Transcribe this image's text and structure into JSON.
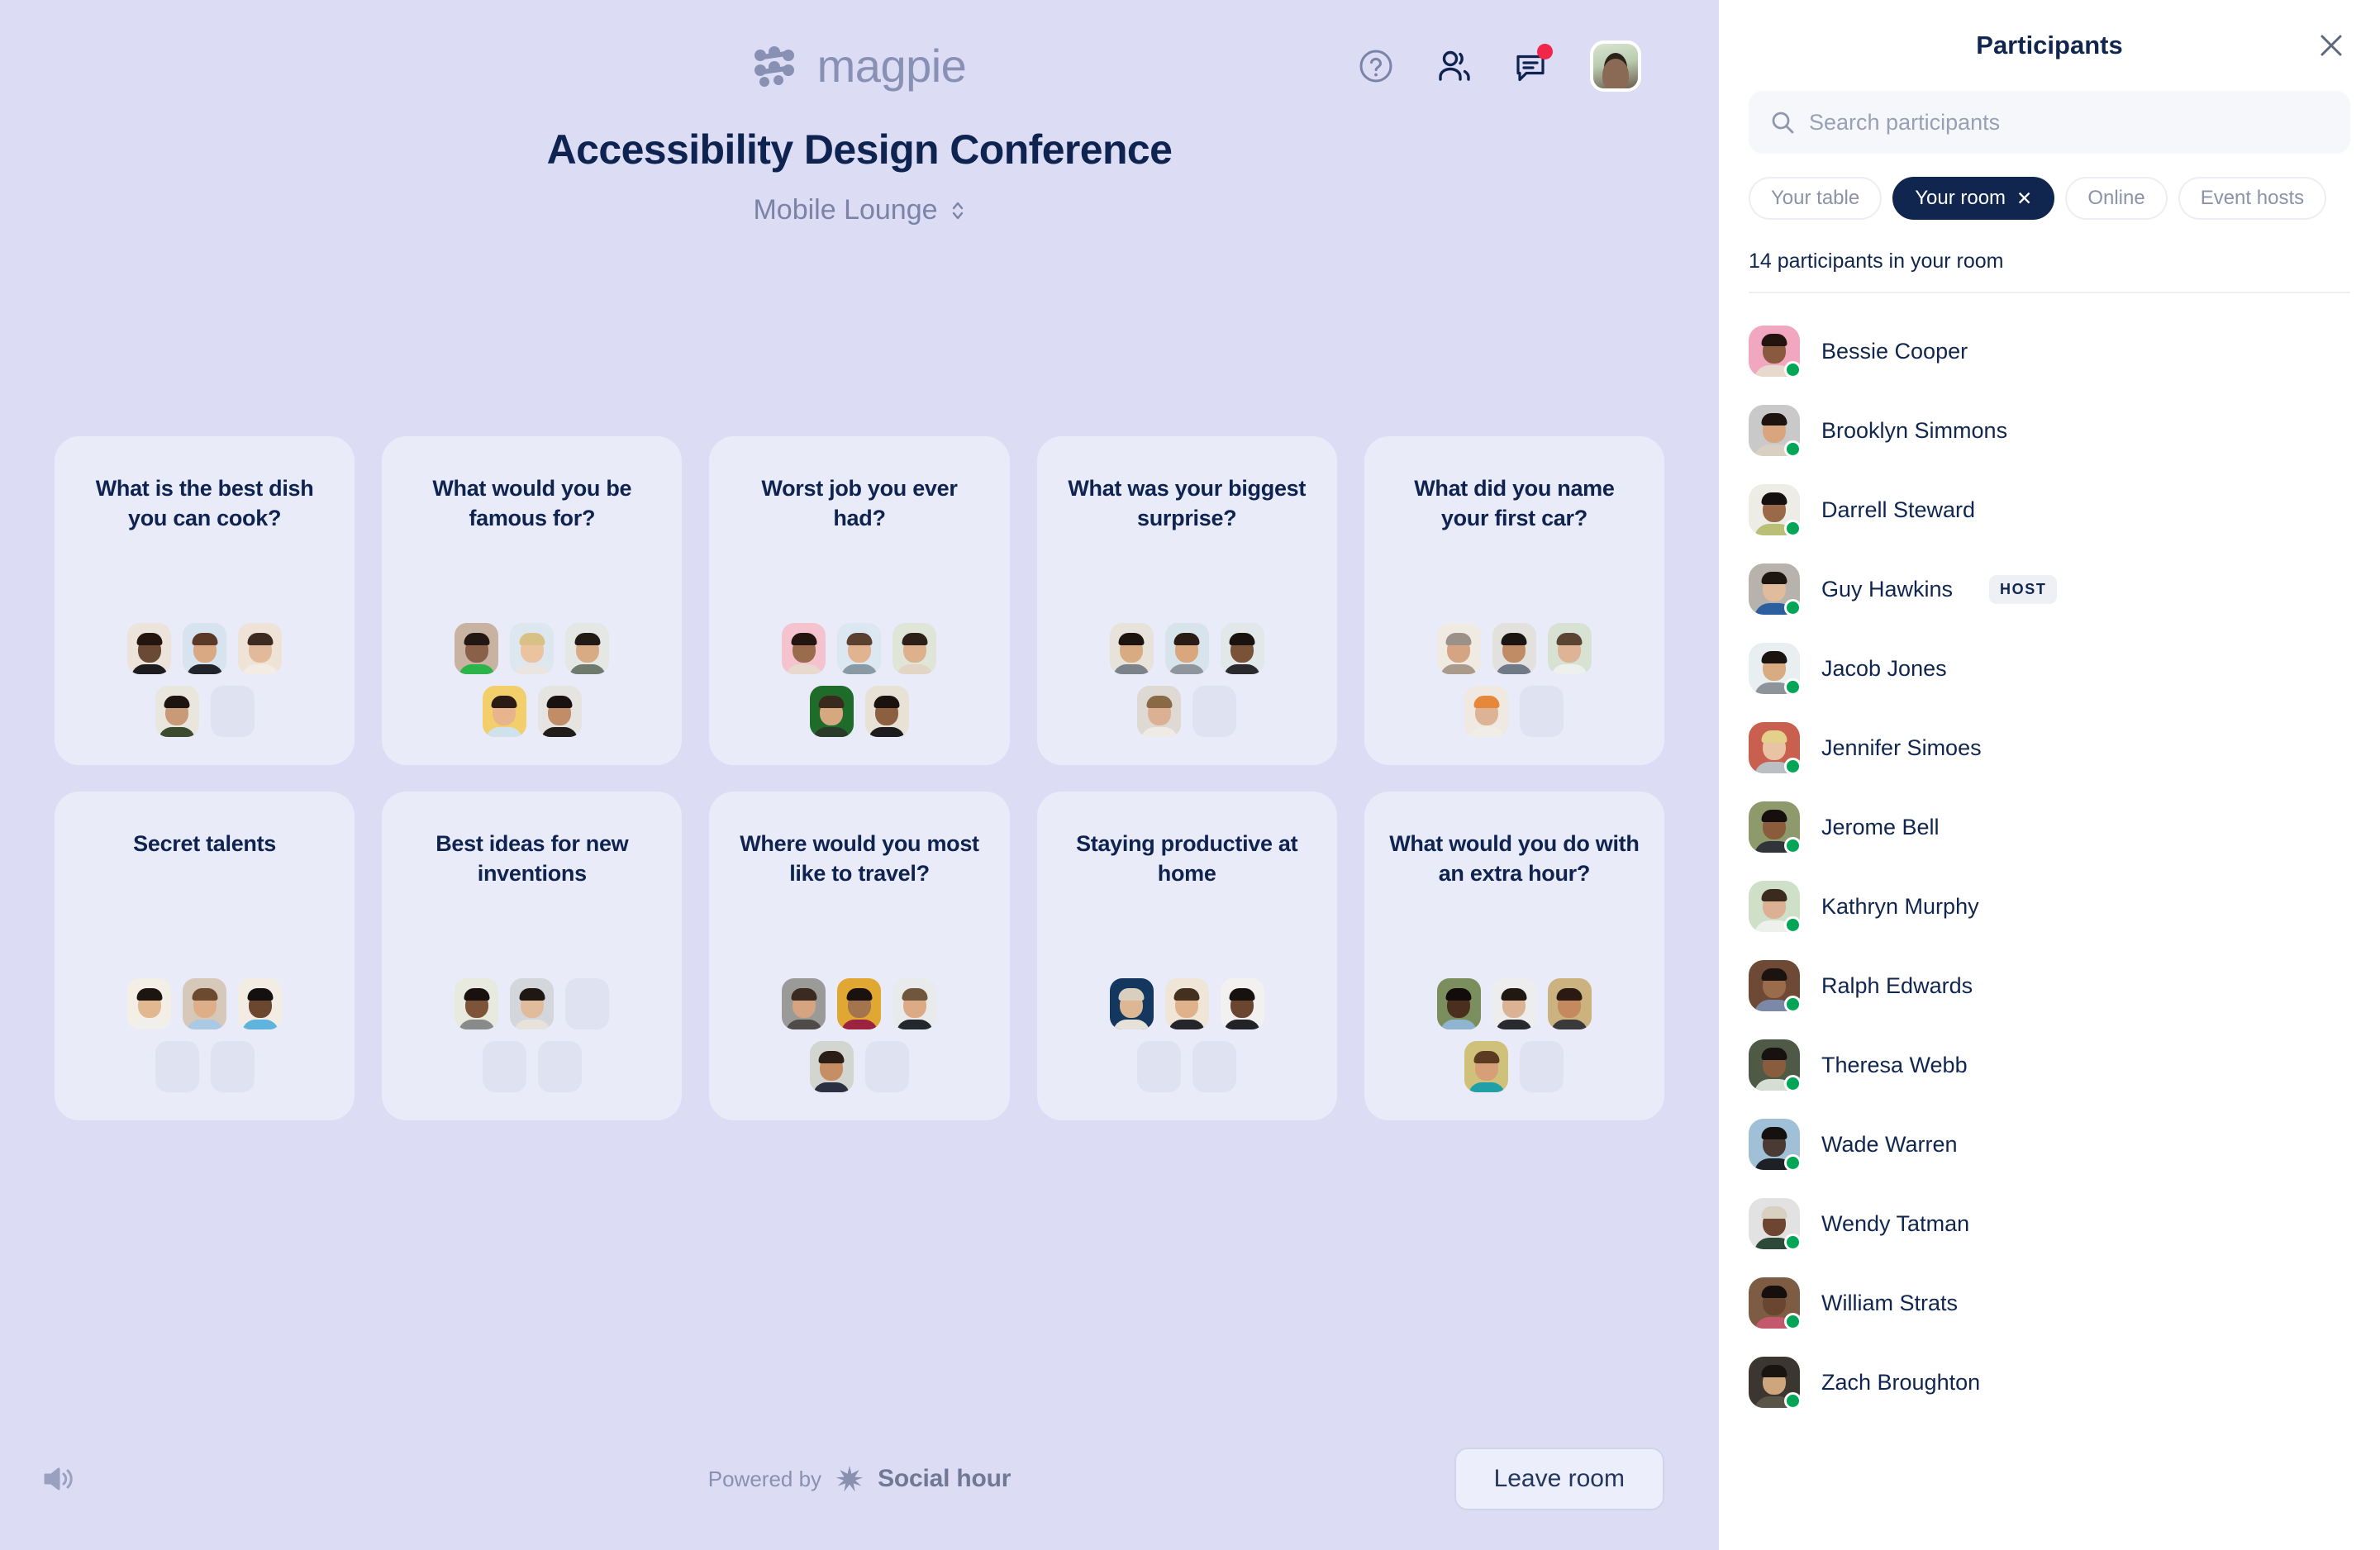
{
  "brand": {
    "name": "magpie",
    "logo_icon": "magpie-logo-icon"
  },
  "header": {
    "event_title": "Accessibility Design Conference",
    "room_name": "Mobile Lounge",
    "room_caret_icon": "chevron-updown-icon",
    "help_icon": "help-circle-icon",
    "participants_icon": "people-icon",
    "chat_icon": "chat-bubble-icon",
    "chat_badge": true,
    "avatar_icon": "user-avatar"
  },
  "topics": [
    {
      "title": "What is the best dish you can cook?",
      "seats": [
        {
          "occupied": true,
          "bg": "#ece4da",
          "head": "#6a4a35",
          "hair": "#24160f",
          "body": "#1c1c20"
        },
        {
          "occupied": true,
          "bg": "#d7e3ee",
          "head": "#d8a983",
          "hair": "#5a3a27",
          "body": "#22242c"
        },
        {
          "occupied": true,
          "bg": "#efe2d6",
          "head": "#e2b99b",
          "hair": "#3d2a20",
          "body": "#f2ece4"
        },
        {
          "occupied": true,
          "bg": "#e9e7dd",
          "head": "#c89a78",
          "hair": "#1d1410",
          "body": "#3c4a2e"
        },
        {
          "occupied": false
        }
      ]
    },
    {
      "title": "What would you be famous for?",
      "seats": [
        {
          "occupied": true,
          "bg": "#c8b2a1",
          "head": "#8a6148",
          "hair": "#221712",
          "body": "#2cb34a"
        },
        {
          "occupied": true,
          "bg": "#dde7ef",
          "head": "#ecc39f",
          "hair": "#d9c084",
          "body": "#e9e6e2"
        },
        {
          "occupied": true,
          "bg": "#e4e7e3",
          "head": "#d8ab85",
          "hair": "#221a14",
          "body": "#6e7a6b"
        },
        {
          "occupied": true,
          "bg": "#f2cf6a",
          "head": "#e7b48d",
          "hair": "#2a1c14",
          "body": "#cfe2ec"
        },
        {
          "occupied": true,
          "bg": "#e6e4e1",
          "head": "#c08d66",
          "hair": "#1a1210",
          "body": "#201d1c"
        }
      ]
    },
    {
      "title": "Worst job you ever had?",
      "seats": [
        {
          "occupied": true,
          "bg": "#f4c3cd",
          "head": "#9a6b4c",
          "hair": "#241510",
          "body": "#e7d9cd"
        },
        {
          "occupied": true,
          "bg": "#dce8f1",
          "head": "#e2b391",
          "hair": "#5d4130",
          "body": "#8a9aa5"
        },
        {
          "occupied": true,
          "bg": "#dfe6d8",
          "head": "#dcb18c",
          "hair": "#2e2018",
          "body": "#e3d5c6"
        },
        {
          "occupied": true,
          "bg": "#1f6b2a",
          "head": "#d6a87f",
          "hair": "#3a2a1d",
          "body": "#2a3b2a"
        },
        {
          "occupied": true,
          "bg": "#e8e1d6",
          "head": "#8b5f40",
          "hair": "#1b1210",
          "body": "#1e1c1f"
        }
      ]
    },
    {
      "title": "What was your biggest surprise?",
      "seats": [
        {
          "occupied": true,
          "bg": "#e7e3da",
          "head": "#d8ab83",
          "hair": "#1d1410",
          "body": "#7c8289"
        },
        {
          "occupied": true,
          "bg": "#d8e4ec",
          "head": "#d9a67e",
          "hair": "#2a1c14",
          "body": "#8e959c"
        },
        {
          "occupied": true,
          "bg": "#e2e7ea",
          "head": "#7a5238",
          "hair": "#1a120e",
          "body": "#2a2a2e"
        },
        {
          "occupied": true,
          "bg": "#ded9d2",
          "head": "#dcb092",
          "hair": "#8a6a46",
          "body": "#eeebe6"
        },
        {
          "occupied": false
        }
      ]
    },
    {
      "title": "What did you name your first car?",
      "seats": [
        {
          "occupied": true,
          "bg": "#efeae2",
          "head": "#d4a483",
          "hair": "#9c9188",
          "body": "#a99a8c"
        },
        {
          "occupied": true,
          "bg": "#e3e1de",
          "head": "#c08c66",
          "hair": "#1c1410",
          "body": "#6f7a86"
        },
        {
          "occupied": true,
          "bg": "#d7e2d2",
          "head": "#dfb396",
          "hair": "#5b4432",
          "body": "#eef0ee"
        },
        {
          "occupied": true,
          "bg": "#efe9e1",
          "head": "#ddb395",
          "hair": "#e5883a",
          "body": "#f0ece6"
        },
        {
          "occupied": false
        }
      ]
    },
    {
      "title": "Secret talents",
      "seats": [
        {
          "occupied": true,
          "bg": "#f3efe6",
          "head": "#e1b890",
          "hair": "#1d1510",
          "body": "#f0efec"
        },
        {
          "occupied": true,
          "bg": "#d7c9ba",
          "head": "#ddae87",
          "hair": "#6b4a30",
          "body": "#a9c9e4"
        },
        {
          "occupied": true,
          "bg": "#f2ece2",
          "head": "#6c4730",
          "hair": "#141010",
          "body": "#5fb4de"
        },
        {
          "occupied": false
        },
        {
          "occupied": false
        }
      ]
    },
    {
      "title": "Best ideas for new inventions",
      "seats": [
        {
          "occupied": true,
          "bg": "#e8eadf",
          "head": "#7d5438",
          "hair": "#181110",
          "body": "#8a8a8a"
        },
        {
          "occupied": true,
          "bg": "#d3d6da",
          "head": "#e0bc9c",
          "hair": "#1e1712",
          "body": "#e8e3da"
        },
        {
          "occupied": false
        },
        {
          "occupied": false
        },
        {
          "occupied": false
        }
      ]
    },
    {
      "title": "Where would you most like to travel?",
      "seats": [
        {
          "occupied": true,
          "bg": "#9a9a99",
          "head": "#d6a480",
          "hair": "#3a2a1f",
          "body": "#4e4b49"
        },
        {
          "occupied": true,
          "bg": "#e0a832",
          "head": "#a3754f",
          "hair": "#1a1210",
          "body": "#9c2340"
        },
        {
          "occupied": true,
          "bg": "#e8eaec",
          "head": "#dcaa84",
          "hair": "#6f563c",
          "body": "#23272e"
        },
        {
          "occupied": true,
          "bg": "#d3d5d0",
          "head": "#c58e63",
          "hair": "#2c1e16",
          "body": "#2b3140"
        },
        {
          "occupied": false
        }
      ]
    },
    {
      "title": "Staying productive at home",
      "seats": [
        {
          "occupied": true,
          "bg": "#14375f",
          "head": "#ddb794",
          "hair": "#d8cfbe",
          "body": "#e6e2da"
        },
        {
          "occupied": true,
          "bg": "#efe6d8",
          "head": "#e0b28c",
          "hair": "#43301f",
          "body": "#25262b"
        },
        {
          "occupied": true,
          "bg": "#f2f1ef",
          "head": "#6a4530",
          "hair": "#171210",
          "body": "#232327"
        },
        {
          "occupied": false
        },
        {
          "occupied": false
        }
      ]
    },
    {
      "title": "What would you do with an extra hour?",
      "seats": [
        {
          "occupied": true,
          "bg": "#7b8f5e",
          "head": "#4a2f1e",
          "hair": "#120d0b",
          "body": "#8fb4d2"
        },
        {
          "occupied": true,
          "bg": "#ededee",
          "head": "#dcb295",
          "hair": "#221812",
          "body": "#2a2a2e"
        },
        {
          "occupied": true,
          "bg": "#cbb27e",
          "head": "#c4895e",
          "hair": "#2a1a12",
          "body": "#3a3a3d"
        },
        {
          "occupied": true,
          "bg": "#cfc07a",
          "head": "#d69f78",
          "hair": "#5d3a22",
          "body": "#1fa0a6"
        },
        {
          "occupied": false
        }
      ]
    }
  ],
  "footer": {
    "sound_icon": "speaker-icon",
    "powered_label": "Powered by",
    "partner_icon": "social-hour-star-icon",
    "partner_name": "Social hour",
    "leave_label": "Leave room"
  },
  "panel": {
    "title": "Participants",
    "close_icon": "close-icon",
    "search": {
      "icon": "search-icon",
      "placeholder": "Search participants",
      "value": ""
    },
    "filters": [
      {
        "label": "Your table",
        "active": false,
        "removable": false
      },
      {
        "label": "Your room",
        "active": true,
        "removable": true,
        "remove_icon": "close-small-icon"
      },
      {
        "label": "Online",
        "active": false,
        "removable": false
      },
      {
        "label": "Event hosts",
        "active": false,
        "removable": false
      }
    ],
    "count_text": "14 participants in your room",
    "host_badge_label": "HOST",
    "participants": [
      {
        "name": "Bessie Cooper",
        "online": true,
        "host": false,
        "bg": "#f2a7c0",
        "head": "#8a5a3e",
        "hair": "#241410",
        "body": "#e7d9cd"
      },
      {
        "name": "Brooklyn Simmons",
        "online": true,
        "host": false,
        "bg": "#c9c9c9",
        "head": "#d8a57f",
        "hair": "#1d1410",
        "body": "#d9cfc2"
      },
      {
        "name": "Darrell Steward",
        "online": true,
        "host": false,
        "bg": "#eeece6",
        "head": "#9a6a48",
        "hair": "#141010",
        "body": "#b9bf74"
      },
      {
        "name": "Guy Hawkins",
        "online": true,
        "host": true,
        "bg": "#b7b2ab",
        "head": "#e0bb9c",
        "hair": "#1d1510",
        "body": "#2b5f9e"
      },
      {
        "name": "Jacob Jones",
        "online": true,
        "host": false,
        "bg": "#e9eef0",
        "head": "#d8ab80",
        "hair": "#1b1310",
        "body": "#8d959b"
      },
      {
        "name": "Jennifer Simoes",
        "online": true,
        "host": false,
        "bg": "#c9604f",
        "head": "#e8c3a4",
        "hair": "#e3d08a",
        "body": "#b9bfc2"
      },
      {
        "name": "Jerome Bell",
        "online": true,
        "host": false,
        "bg": "#8f9a6c",
        "head": "#8a5c3c",
        "hair": "#15100d",
        "body": "#31353a"
      },
      {
        "name": "Kathryn Murphy",
        "online": true,
        "host": false,
        "bg": "#cfe0c8",
        "head": "#dcb092",
        "hair": "#3b2a1e",
        "body": "#eef0ee"
      },
      {
        "name": "Ralph Edwards",
        "online": true,
        "host": false,
        "bg": "#6e4a36",
        "head": "#9a6c4c",
        "hair": "#1a1310",
        "body": "#7b88a8"
      },
      {
        "name": "Theresa Webb",
        "online": true,
        "host": false,
        "bg": "#4e5a45",
        "head": "#8a5c3e",
        "hair": "#171110",
        "body": "#d6ddd4"
      },
      {
        "name": "Wade Warren",
        "online": true,
        "host": false,
        "bg": "#9fc0d6",
        "head": "#4a3a33",
        "hair": "#14110f",
        "body": "#1d2024"
      },
      {
        "name": "Wendy Tatman",
        "online": true,
        "host": false,
        "bg": "#e2e2e2",
        "head": "#6e4530",
        "hair": "#d8d0c0",
        "body": "#2d4a38"
      },
      {
        "name": "William Strats",
        "online": true,
        "host": false,
        "bg": "#7e5c44",
        "head": "#6a4530",
        "hair": "#15100d",
        "body": "#c4596e"
      },
      {
        "name": "Zach Broughton",
        "online": true,
        "host": false,
        "bg": "#3b3630",
        "head": "#cfa57e",
        "hair": "#1a1410",
        "body": "#5a5347"
      }
    ]
  }
}
